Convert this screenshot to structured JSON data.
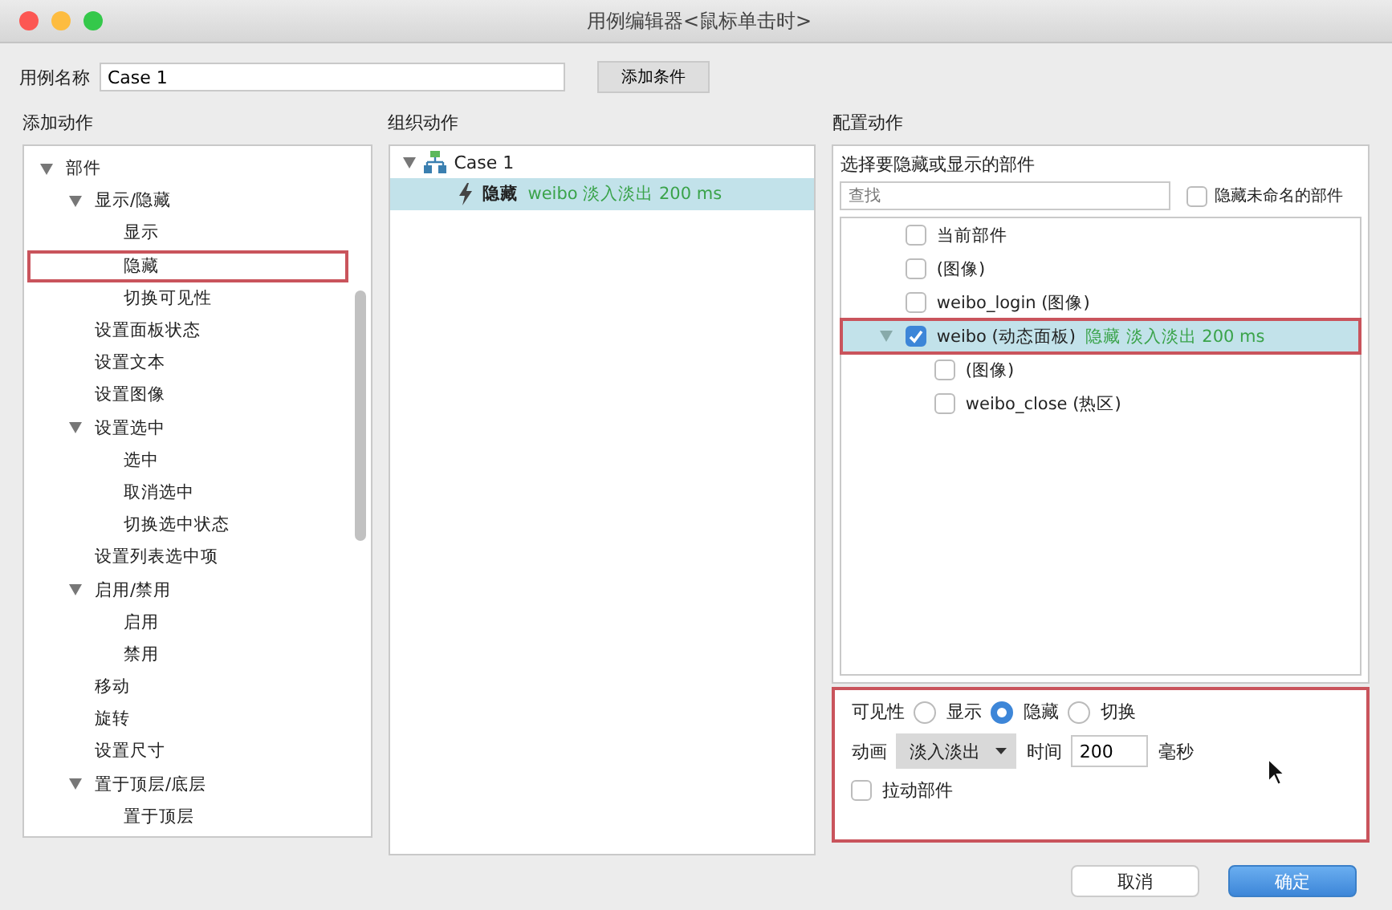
{
  "window": {
    "title": "用例编辑器<鼠标单击时>"
  },
  "case_name": {
    "label": "用例名称",
    "value": "Case 1"
  },
  "add_condition_button": "添加条件",
  "add_actions": {
    "heading": "添加动作",
    "tree": [
      {
        "label": "部件",
        "expanded": true,
        "highlighted": false,
        "children": [
          {
            "label": "显示/隐藏",
            "expanded": true,
            "highlighted": false,
            "children": [
              {
                "label": "显示",
                "highlighted": false
              },
              {
                "label": "隐藏",
                "highlighted": true
              },
              {
                "label": "切换可见性",
                "highlighted": false
              }
            ]
          },
          {
            "label": "设置面板状态",
            "highlighted": false
          },
          {
            "label": "设置文本",
            "highlighted": false
          },
          {
            "label": "设置图像",
            "highlighted": false
          },
          {
            "label": "设置选中",
            "expanded": true,
            "highlighted": false,
            "children": [
              {
                "label": "选中",
                "highlighted": false
              },
              {
                "label": "取消选中",
                "highlighted": false
              },
              {
                "label": "切换选中状态",
                "highlighted": false
              }
            ]
          },
          {
            "label": "设置列表选中项",
            "highlighted": false
          },
          {
            "label": "启用/禁用",
            "expanded": true,
            "highlighted": false,
            "children": [
              {
                "label": "启用",
                "highlighted": false
              },
              {
                "label": "禁用",
                "highlighted": false
              }
            ]
          },
          {
            "label": "移动",
            "highlighted": false
          },
          {
            "label": "旋转",
            "highlighted": false
          },
          {
            "label": "设置尺寸",
            "highlighted": false
          },
          {
            "label": "置于顶层/底层",
            "expanded": true,
            "highlighted": false,
            "children": [
              {
                "label": "置于顶层",
                "highlighted": false
              }
            ]
          }
        ]
      }
    ]
  },
  "organize_actions": {
    "heading": "组织动作",
    "cases": [
      {
        "label": "Case 1",
        "expanded": true,
        "actions": [
          {
            "verb": "隐藏",
            "detail": "weibo 淡入淡出 200 ms",
            "selected": true
          }
        ]
      }
    ]
  },
  "configure_actions": {
    "heading": "配置动作",
    "widget_picker": {
      "title": "选择要隐藏或显示的部件",
      "search": {
        "placeholder": "查找"
      },
      "hide_unnamed": {
        "label": "隐藏未命名的部件",
        "checked": false
      },
      "widgets": [
        {
          "label": "当前部件",
          "checked": false,
          "selected": false,
          "highlighted": false
        },
        {
          "label": "(图像)",
          "checked": false,
          "selected": false,
          "highlighted": false
        },
        {
          "label": "weibo_login (图像)",
          "checked": false,
          "selected": false,
          "highlighted": false
        },
        {
          "label": "weibo (动态面板)",
          "note": "隐藏 淡入淡出 200 ms",
          "checked": true,
          "selected": true,
          "highlighted": true,
          "expanded": true,
          "children": [
            {
              "label": "(图像)",
              "checked": false,
              "selected": false,
              "highlighted": false
            },
            {
              "label": "weibo_close (热区)",
              "checked": false,
              "selected": false,
              "highlighted": false
            }
          ]
        }
      ]
    },
    "settings": {
      "highlighted": true,
      "visibility": {
        "label": "可见性",
        "options": [
          {
            "label": "显示",
            "selected": false
          },
          {
            "label": "隐藏",
            "selected": true
          },
          {
            "label": "切换",
            "selected": false
          }
        ]
      },
      "animation": {
        "label": "动画",
        "value": "淡入淡出"
      },
      "duration": {
        "label": "时间",
        "value": "200",
        "unit": "毫秒"
      },
      "drag_widget": {
        "label": "拉动部件",
        "checked": false
      }
    }
  },
  "buttons": [
    {
      "label": "取消",
      "kind": "secondary"
    },
    {
      "label": "确定",
      "kind": "primary"
    }
  ]
}
